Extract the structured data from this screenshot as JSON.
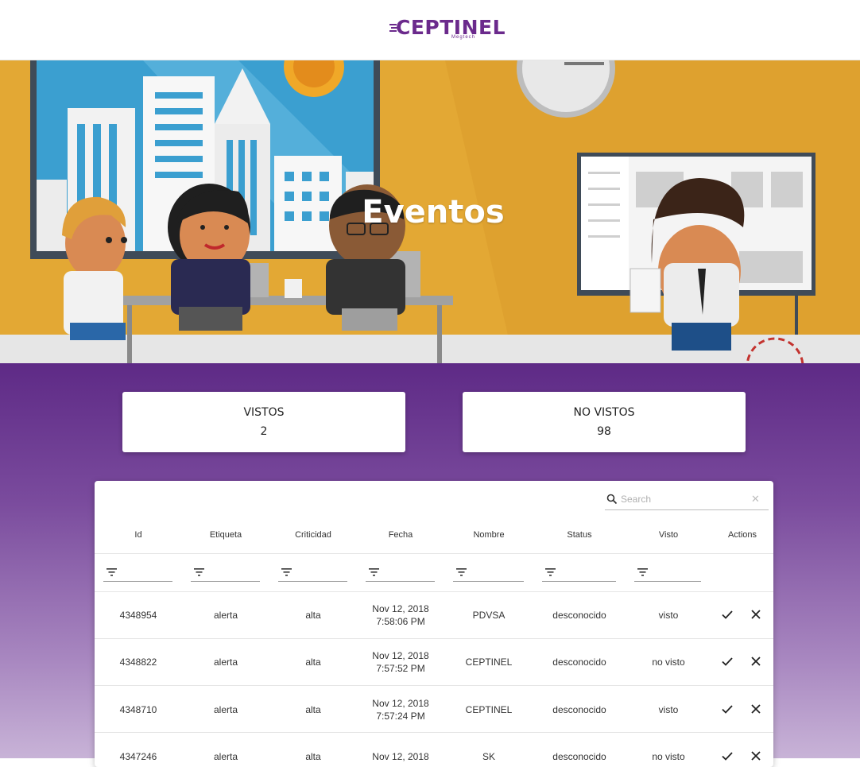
{
  "brand": {
    "logo_text": "CEPTINEL",
    "logo_sub": "Megtech"
  },
  "hero": {
    "title": "Eventos"
  },
  "stats": [
    {
      "label": "VISTOS",
      "value": "2"
    },
    {
      "label": "NO VISTOS",
      "value": "98"
    }
  ],
  "table": {
    "search_placeholder": "Search",
    "headers": [
      "Id",
      "Etiqueta",
      "Criticidad",
      "Fecha",
      "Nombre",
      "Status",
      "Visto",
      "Actions"
    ],
    "rows": [
      {
        "id": "4348954",
        "etiqueta": "alerta",
        "criticidad": "alta",
        "fecha_date": "Nov 12, 2018",
        "fecha_time": "7:58:06 PM",
        "nombre": "PDVSA",
        "status": "desconocido",
        "visto": "visto"
      },
      {
        "id": "4348822",
        "etiqueta": "alerta",
        "criticidad": "alta",
        "fecha_date": "Nov 12, 2018",
        "fecha_time": "7:57:52 PM",
        "nombre": "CEPTINEL",
        "status": "desconocido",
        "visto": "no visto"
      },
      {
        "id": "4348710",
        "etiqueta": "alerta",
        "criticidad": "alta",
        "fecha_date": "Nov 12, 2018",
        "fecha_time": "7:57:24 PM",
        "nombre": "CEPTINEL",
        "status": "desconocido",
        "visto": "visto"
      },
      {
        "id": "4347246",
        "etiqueta": "alerta",
        "criticidad": "alta",
        "fecha_date": "Nov 12, 2018",
        "fecha_time": "",
        "nombre": "SK",
        "status": "desconocido",
        "visto": "no visto"
      }
    ]
  },
  "colors": {
    "brand_purple": "#6b2a8c",
    "gradient_top": "#5e2a86",
    "gradient_bottom": "#c8b3d7",
    "hero_wall": "#e0a630"
  }
}
